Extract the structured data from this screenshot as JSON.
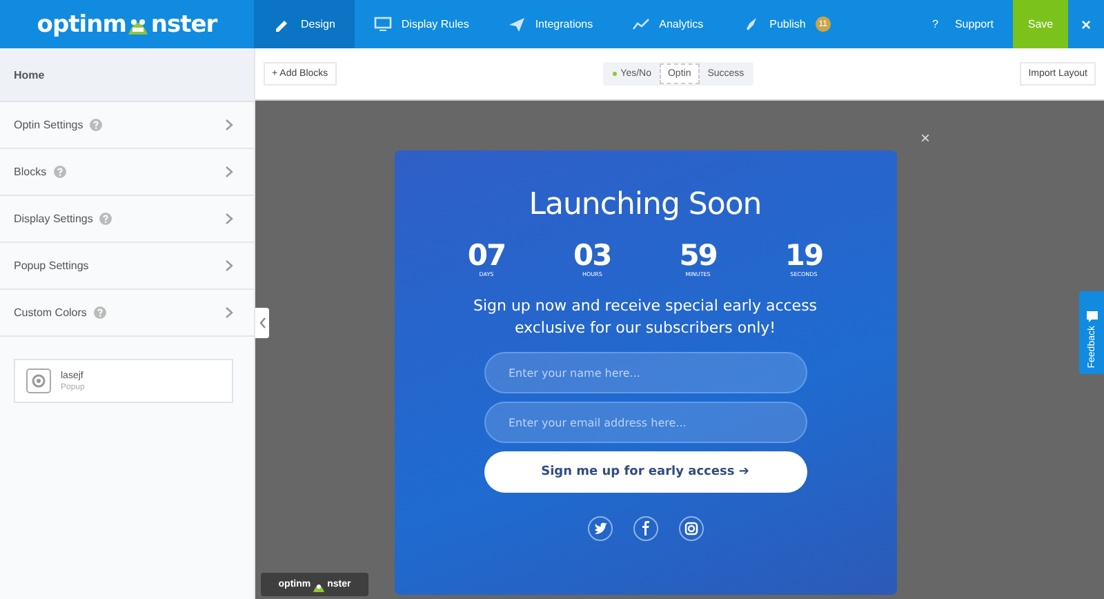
{
  "logo": {
    "before": "optinm",
    "after": "nster"
  },
  "nav": [
    {
      "label": "Design",
      "selected": true
    },
    {
      "label": "Display Rules",
      "selected": false
    },
    {
      "label": "Integrations",
      "selected": false
    },
    {
      "label": "Analytics",
      "selected": false
    },
    {
      "label": "Publish",
      "selected": false,
      "badge": "11"
    }
  ],
  "support": {
    "icon": "?",
    "label": "Support"
  },
  "save": "Save",
  "close": "×",
  "sidebar": {
    "title": "Home",
    "items": [
      {
        "label": "Optin Settings",
        "help": true
      },
      {
        "label": "Blocks",
        "help": true
      },
      {
        "label": "Display Settings",
        "help": true
      },
      {
        "label": "Popup Settings",
        "help": false
      },
      {
        "label": "Custom Colors",
        "help": true
      }
    ],
    "campaign": {
      "name": "lasejf",
      "type": "Popup"
    }
  },
  "toolbar": {
    "add": "+ Add Blocks",
    "views": [
      {
        "label": "Yes/No",
        "dot": true,
        "selected": false
      },
      {
        "label": "Optin",
        "dot": false,
        "selected": true
      },
      {
        "label": "Success",
        "dot": false,
        "selected": false
      }
    ],
    "import": "Import Layout"
  },
  "popup": {
    "close": "×",
    "title": "Launching Soon",
    "countdown": [
      {
        "value": "07",
        "unit": "DAYS"
      },
      {
        "value": "03",
        "unit": "HOURS"
      },
      {
        "value": "59",
        "unit": "MINUTES"
      },
      {
        "value": "19",
        "unit": "SECONDS"
      }
    ],
    "text": "Sign up now and receive special early access exclusive for our subscribers only!",
    "fields": [
      {
        "placeholder": "Enter your name here..."
      },
      {
        "placeholder": "Enter your email address here..."
      }
    ],
    "button": "Sign me up for early access ➔"
  },
  "feedback": "Feedback",
  "badge": {
    "before": "optinm",
    "after": "nster"
  }
}
